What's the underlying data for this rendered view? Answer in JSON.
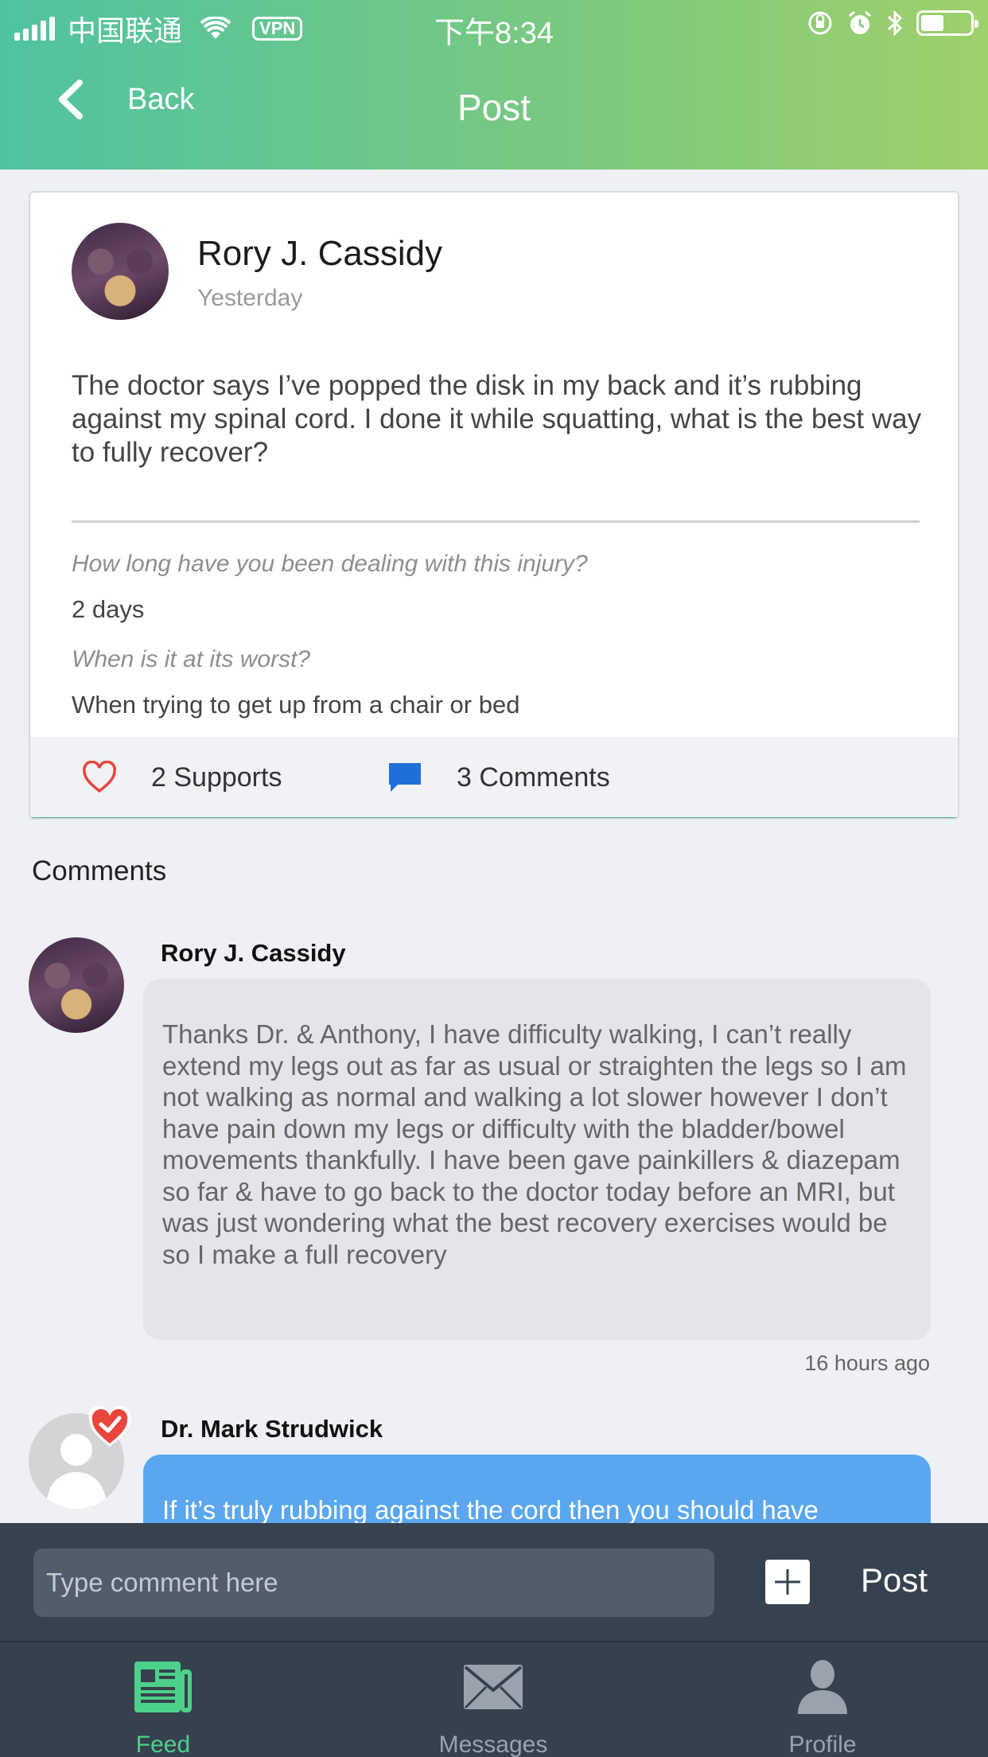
{
  "status_bar": {
    "carrier": "中国联通",
    "vpn": "VPN",
    "time": "下午8:34"
  },
  "nav": {
    "back_label": "Back",
    "title": "Post"
  },
  "post": {
    "author": "Rory J. Cassidy",
    "time": "Yesterday",
    "body": "The doctor says I’ve popped the disk in my back and it’s rubbing against my spinal cord. I done it while squatting, what is the best way to fully recover?",
    "questions": [
      {
        "question": "How long have you been dealing with this injury?",
        "answer": "2 days"
      },
      {
        "question": "When is it at its worst?",
        "answer": "When trying to get up from a chair or bed"
      }
    ],
    "supports_label": "2 Supports",
    "comments_label": "3 Comments"
  },
  "comments": {
    "title": "Comments",
    "items": [
      {
        "author": "Rory J. Cassidy",
        "text": "Thanks Dr. & Anthony, I have difficulty walking, I can’t really extend my legs out as far as usual or straighten the legs so I am not walking as normal and walking a lot slower however I don’t have pain down my legs or difficulty with the bladder/bowel movements thankfully. I have been gave painkillers & diazepam so far & have to go back to the doctor today before an MRI, but was just wondering what the best recovery exercises would be so I make a full recovery",
        "time": "16 hours ago"
      },
      {
        "author": "Dr. Mark Strudwick",
        "text": "If it’s truly rubbing against the cord then you should have"
      }
    ]
  },
  "composer": {
    "placeholder": "Type comment here",
    "post_label": "Post"
  },
  "tabs": [
    {
      "label": "Feed",
      "icon": "feed-icon",
      "active": true
    },
    {
      "label": "Messages",
      "icon": "envelope-icon",
      "active": false
    },
    {
      "label": "Profile",
      "icon": "person-icon",
      "active": false
    }
  ],
  "colors": {
    "header_start": "#4fc3a1",
    "header_end": "#9fd06b",
    "accent_green": "#4caf87",
    "heart": "#e8453c",
    "comment_icon": "#1e6fd6",
    "doctor_bubble": "#5aa7ef",
    "active_tab": "#4cd18a"
  }
}
